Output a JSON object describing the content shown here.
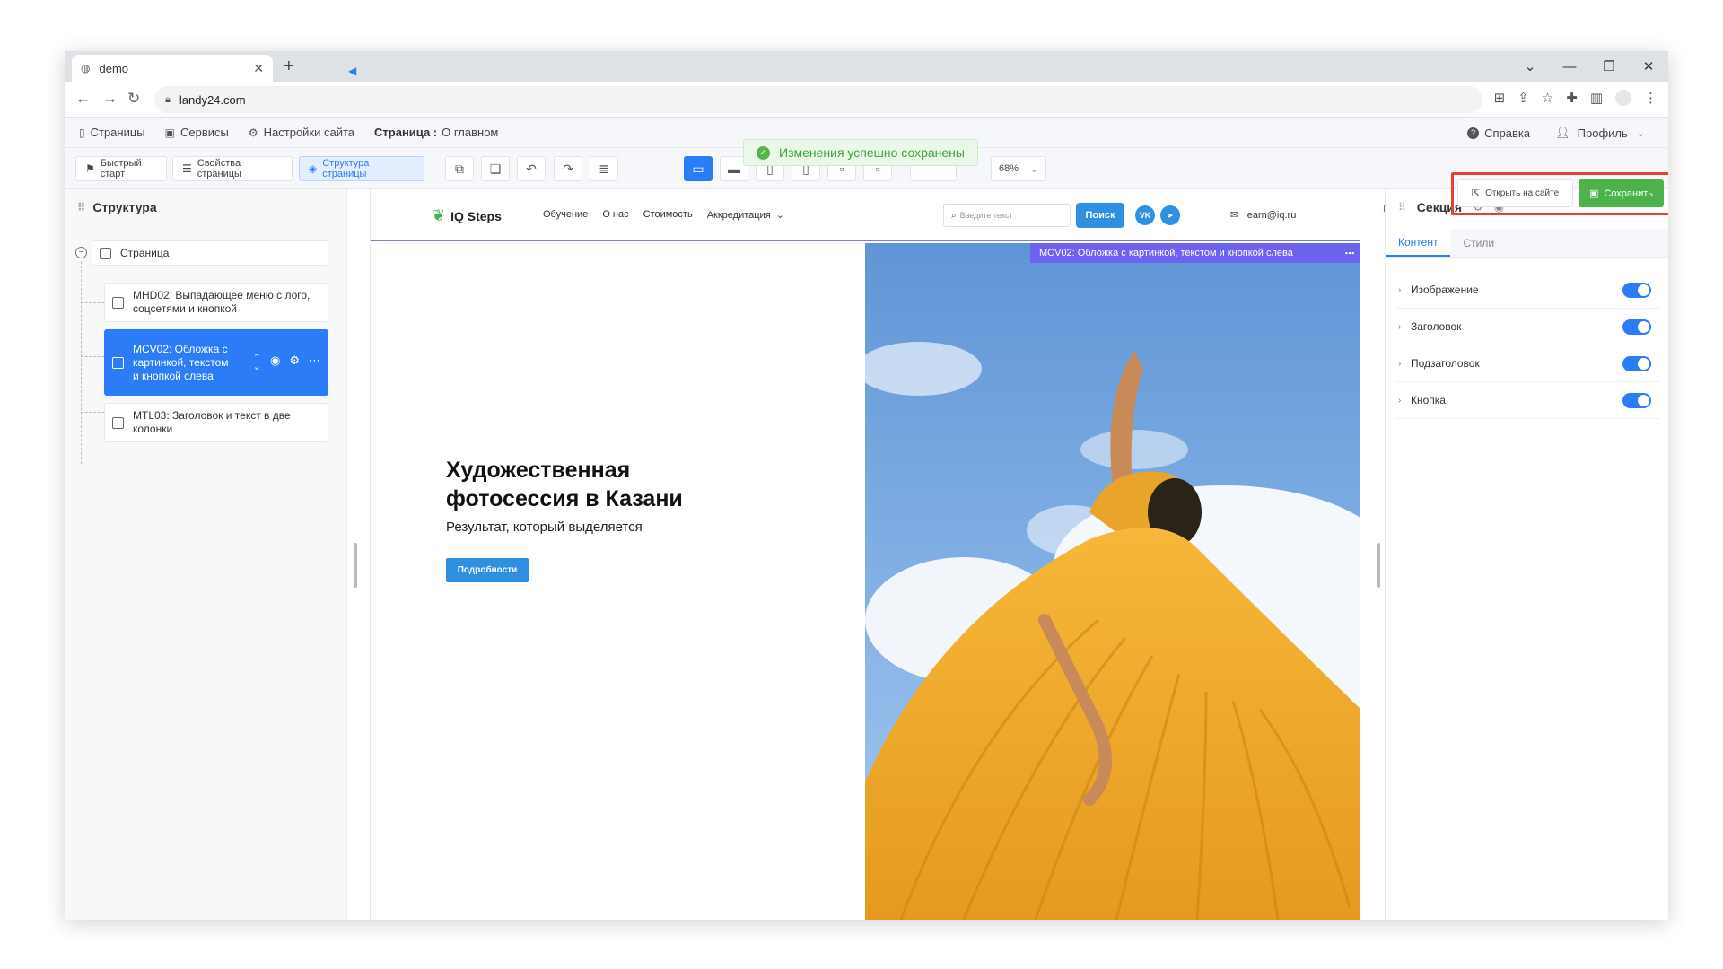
{
  "browser": {
    "tab_title": "demo",
    "tab_close": "✕",
    "new_tab": "+",
    "url": "landy24.com",
    "window_controls": [
      "⌄",
      "—",
      "❐",
      "✕"
    ]
  },
  "menubar": {
    "items": [
      {
        "icon": "page-icon",
        "glyph": "▯",
        "label": "Страницы"
      },
      {
        "icon": "services-icon",
        "glyph": "▣",
        "label": "Сервисы"
      },
      {
        "icon": "gear-icon",
        "glyph": "⚙",
        "label": "Настройки сайта"
      }
    ],
    "page_label": "Страница :",
    "page_name": "О главном",
    "help": "Справка",
    "profile": "Профиль"
  },
  "toolbar": {
    "quick_start": "Быстрый старт",
    "page_props": "Свойства страницы",
    "page_structure": "Структура страницы",
    "zoom": "68%",
    "open_on_site": "Открыть на сайте",
    "save": "Сохранить"
  },
  "toast": {
    "message": "Изменения успешно сохранены"
  },
  "structure_panel": {
    "title": "Структура",
    "root": "Страница",
    "nodes": [
      {
        "label": "MHD02: Выпадающее меню с лого, соцсетями и кнопкой"
      },
      {
        "label": "MCV02: Обложка с картинкой, текстом и кнопкой слева"
      },
      {
        "label": "MTL03: Заголовок и текст в две колонки"
      }
    ]
  },
  "site": {
    "logo": "IQ Steps",
    "nav": [
      "Обучение",
      "О нас",
      "Стоимость",
      "Аккредитация"
    ],
    "search_placeholder": "Введите текст",
    "search_button": "Поиск",
    "social_vk": "VK",
    "social_tg": "➤",
    "email": "learn@iq.ru",
    "section_label": "MCV02: Обложка с картинкой, текстом и кнопкой слева",
    "hero": {
      "title": "Художественная фотосессия в Казани",
      "subtitle": "Результат, который выделяется",
      "button": "Подробности"
    }
  },
  "right_panel": {
    "title": "Секция",
    "tabs": [
      "Контент",
      "Стили"
    ],
    "properties": [
      {
        "label": "Изображение",
        "enabled": true
      },
      {
        "label": "Заголовок",
        "enabled": true
      },
      {
        "label": "Подзаголовок",
        "enabled": true
      },
      {
        "label": "Кнопка",
        "enabled": true
      }
    ]
  },
  "colors": {
    "accent": "#2b7cf6",
    "save_green": "#4cb34a",
    "section_purple": "#6c63ef",
    "highlight_red": "#e8402f"
  }
}
